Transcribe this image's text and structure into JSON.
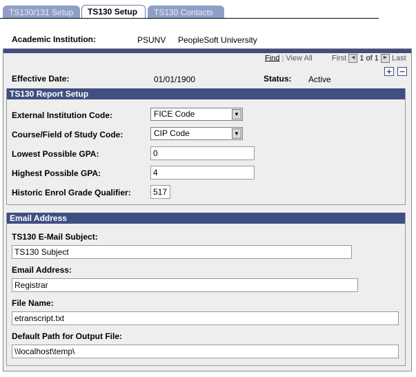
{
  "tabs": [
    {
      "label": "TS130/131 Setup",
      "active": false
    },
    {
      "label": "TS130 Setup",
      "active": true
    },
    {
      "label": "TS130 Contacts",
      "active": false
    }
  ],
  "institution": {
    "label": "Academic Institution:",
    "code": "PSUNV",
    "name": "PeopleSoft University"
  },
  "nav": {
    "find": "Find",
    "view_all": "View All",
    "first": "First",
    "page_info": "1 of 1",
    "last": "Last"
  },
  "effective": {
    "date_label": "Effective Date:",
    "date_value": "01/01/1900",
    "status_label": "Status:",
    "status_value": "Active"
  },
  "report_setup": {
    "title": "TS130 Report Setup",
    "ext_inst_label": "External Institution Code:",
    "ext_inst_value": "FICE Code",
    "course_label": "Course/Field of Study Code:",
    "course_value": "CIP Code",
    "low_gpa_label": "Lowest Possible GPA:",
    "low_gpa_value": "0",
    "high_gpa_label": "Highest Possible GPA:",
    "high_gpa_value": "4",
    "historic_label": "Historic Enrol Grade Qualifier:",
    "historic_value": "517"
  },
  "email": {
    "title": "Email Address",
    "subject_label": "TS130 E-Mail Subject:",
    "subject_value": "TS130 Subject",
    "address_label": "Email Address:",
    "address_value": "Registrar",
    "file_label": "File Name:",
    "file_value": "etranscript.txt",
    "path_label": "Default Path for Output File:",
    "path_value": "\\\\localhost\\temp\\"
  },
  "colors": {
    "accent": "#3f4f82",
    "tab_inactive": "#8f9fc7",
    "panel_bg": "#eeeeee"
  }
}
